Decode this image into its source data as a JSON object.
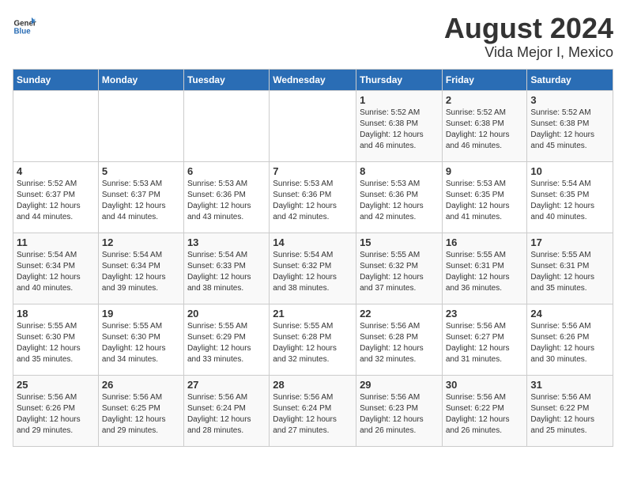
{
  "header": {
    "logo_general": "General",
    "logo_blue": "Blue",
    "title": "August 2024",
    "subtitle": "Vida Mejor I, Mexico"
  },
  "days_of_week": [
    "Sunday",
    "Monday",
    "Tuesday",
    "Wednesday",
    "Thursday",
    "Friday",
    "Saturday"
  ],
  "weeks": [
    [
      {
        "day": "",
        "info": ""
      },
      {
        "day": "",
        "info": ""
      },
      {
        "day": "",
        "info": ""
      },
      {
        "day": "",
        "info": ""
      },
      {
        "day": "1",
        "info": "Sunrise: 5:52 AM\nSunset: 6:38 PM\nDaylight: 12 hours\nand 46 minutes."
      },
      {
        "day": "2",
        "info": "Sunrise: 5:52 AM\nSunset: 6:38 PM\nDaylight: 12 hours\nand 46 minutes."
      },
      {
        "day": "3",
        "info": "Sunrise: 5:52 AM\nSunset: 6:38 PM\nDaylight: 12 hours\nand 45 minutes."
      }
    ],
    [
      {
        "day": "4",
        "info": "Sunrise: 5:52 AM\nSunset: 6:37 PM\nDaylight: 12 hours\nand 44 minutes."
      },
      {
        "day": "5",
        "info": "Sunrise: 5:53 AM\nSunset: 6:37 PM\nDaylight: 12 hours\nand 44 minutes."
      },
      {
        "day": "6",
        "info": "Sunrise: 5:53 AM\nSunset: 6:36 PM\nDaylight: 12 hours\nand 43 minutes."
      },
      {
        "day": "7",
        "info": "Sunrise: 5:53 AM\nSunset: 6:36 PM\nDaylight: 12 hours\nand 42 minutes."
      },
      {
        "day": "8",
        "info": "Sunrise: 5:53 AM\nSunset: 6:36 PM\nDaylight: 12 hours\nand 42 minutes."
      },
      {
        "day": "9",
        "info": "Sunrise: 5:53 AM\nSunset: 6:35 PM\nDaylight: 12 hours\nand 41 minutes."
      },
      {
        "day": "10",
        "info": "Sunrise: 5:54 AM\nSunset: 6:35 PM\nDaylight: 12 hours\nand 40 minutes."
      }
    ],
    [
      {
        "day": "11",
        "info": "Sunrise: 5:54 AM\nSunset: 6:34 PM\nDaylight: 12 hours\nand 40 minutes."
      },
      {
        "day": "12",
        "info": "Sunrise: 5:54 AM\nSunset: 6:34 PM\nDaylight: 12 hours\nand 39 minutes."
      },
      {
        "day": "13",
        "info": "Sunrise: 5:54 AM\nSunset: 6:33 PM\nDaylight: 12 hours\nand 38 minutes."
      },
      {
        "day": "14",
        "info": "Sunrise: 5:54 AM\nSunset: 6:32 PM\nDaylight: 12 hours\nand 38 minutes."
      },
      {
        "day": "15",
        "info": "Sunrise: 5:55 AM\nSunset: 6:32 PM\nDaylight: 12 hours\nand 37 minutes."
      },
      {
        "day": "16",
        "info": "Sunrise: 5:55 AM\nSunset: 6:31 PM\nDaylight: 12 hours\nand 36 minutes."
      },
      {
        "day": "17",
        "info": "Sunrise: 5:55 AM\nSunset: 6:31 PM\nDaylight: 12 hours\nand 35 minutes."
      }
    ],
    [
      {
        "day": "18",
        "info": "Sunrise: 5:55 AM\nSunset: 6:30 PM\nDaylight: 12 hours\nand 35 minutes."
      },
      {
        "day": "19",
        "info": "Sunrise: 5:55 AM\nSunset: 6:30 PM\nDaylight: 12 hours\nand 34 minutes."
      },
      {
        "day": "20",
        "info": "Sunrise: 5:55 AM\nSunset: 6:29 PM\nDaylight: 12 hours\nand 33 minutes."
      },
      {
        "day": "21",
        "info": "Sunrise: 5:55 AM\nSunset: 6:28 PM\nDaylight: 12 hours\nand 32 minutes."
      },
      {
        "day": "22",
        "info": "Sunrise: 5:56 AM\nSunset: 6:28 PM\nDaylight: 12 hours\nand 32 minutes."
      },
      {
        "day": "23",
        "info": "Sunrise: 5:56 AM\nSunset: 6:27 PM\nDaylight: 12 hours\nand 31 minutes."
      },
      {
        "day": "24",
        "info": "Sunrise: 5:56 AM\nSunset: 6:26 PM\nDaylight: 12 hours\nand 30 minutes."
      }
    ],
    [
      {
        "day": "25",
        "info": "Sunrise: 5:56 AM\nSunset: 6:26 PM\nDaylight: 12 hours\nand 29 minutes."
      },
      {
        "day": "26",
        "info": "Sunrise: 5:56 AM\nSunset: 6:25 PM\nDaylight: 12 hours\nand 29 minutes."
      },
      {
        "day": "27",
        "info": "Sunrise: 5:56 AM\nSunset: 6:24 PM\nDaylight: 12 hours\nand 28 minutes."
      },
      {
        "day": "28",
        "info": "Sunrise: 5:56 AM\nSunset: 6:24 PM\nDaylight: 12 hours\nand 27 minutes."
      },
      {
        "day": "29",
        "info": "Sunrise: 5:56 AM\nSunset: 6:23 PM\nDaylight: 12 hours\nand 26 minutes."
      },
      {
        "day": "30",
        "info": "Sunrise: 5:56 AM\nSunset: 6:22 PM\nDaylight: 12 hours\nand 26 minutes."
      },
      {
        "day": "31",
        "info": "Sunrise: 5:56 AM\nSunset: 6:22 PM\nDaylight: 12 hours\nand 25 minutes."
      }
    ]
  ]
}
